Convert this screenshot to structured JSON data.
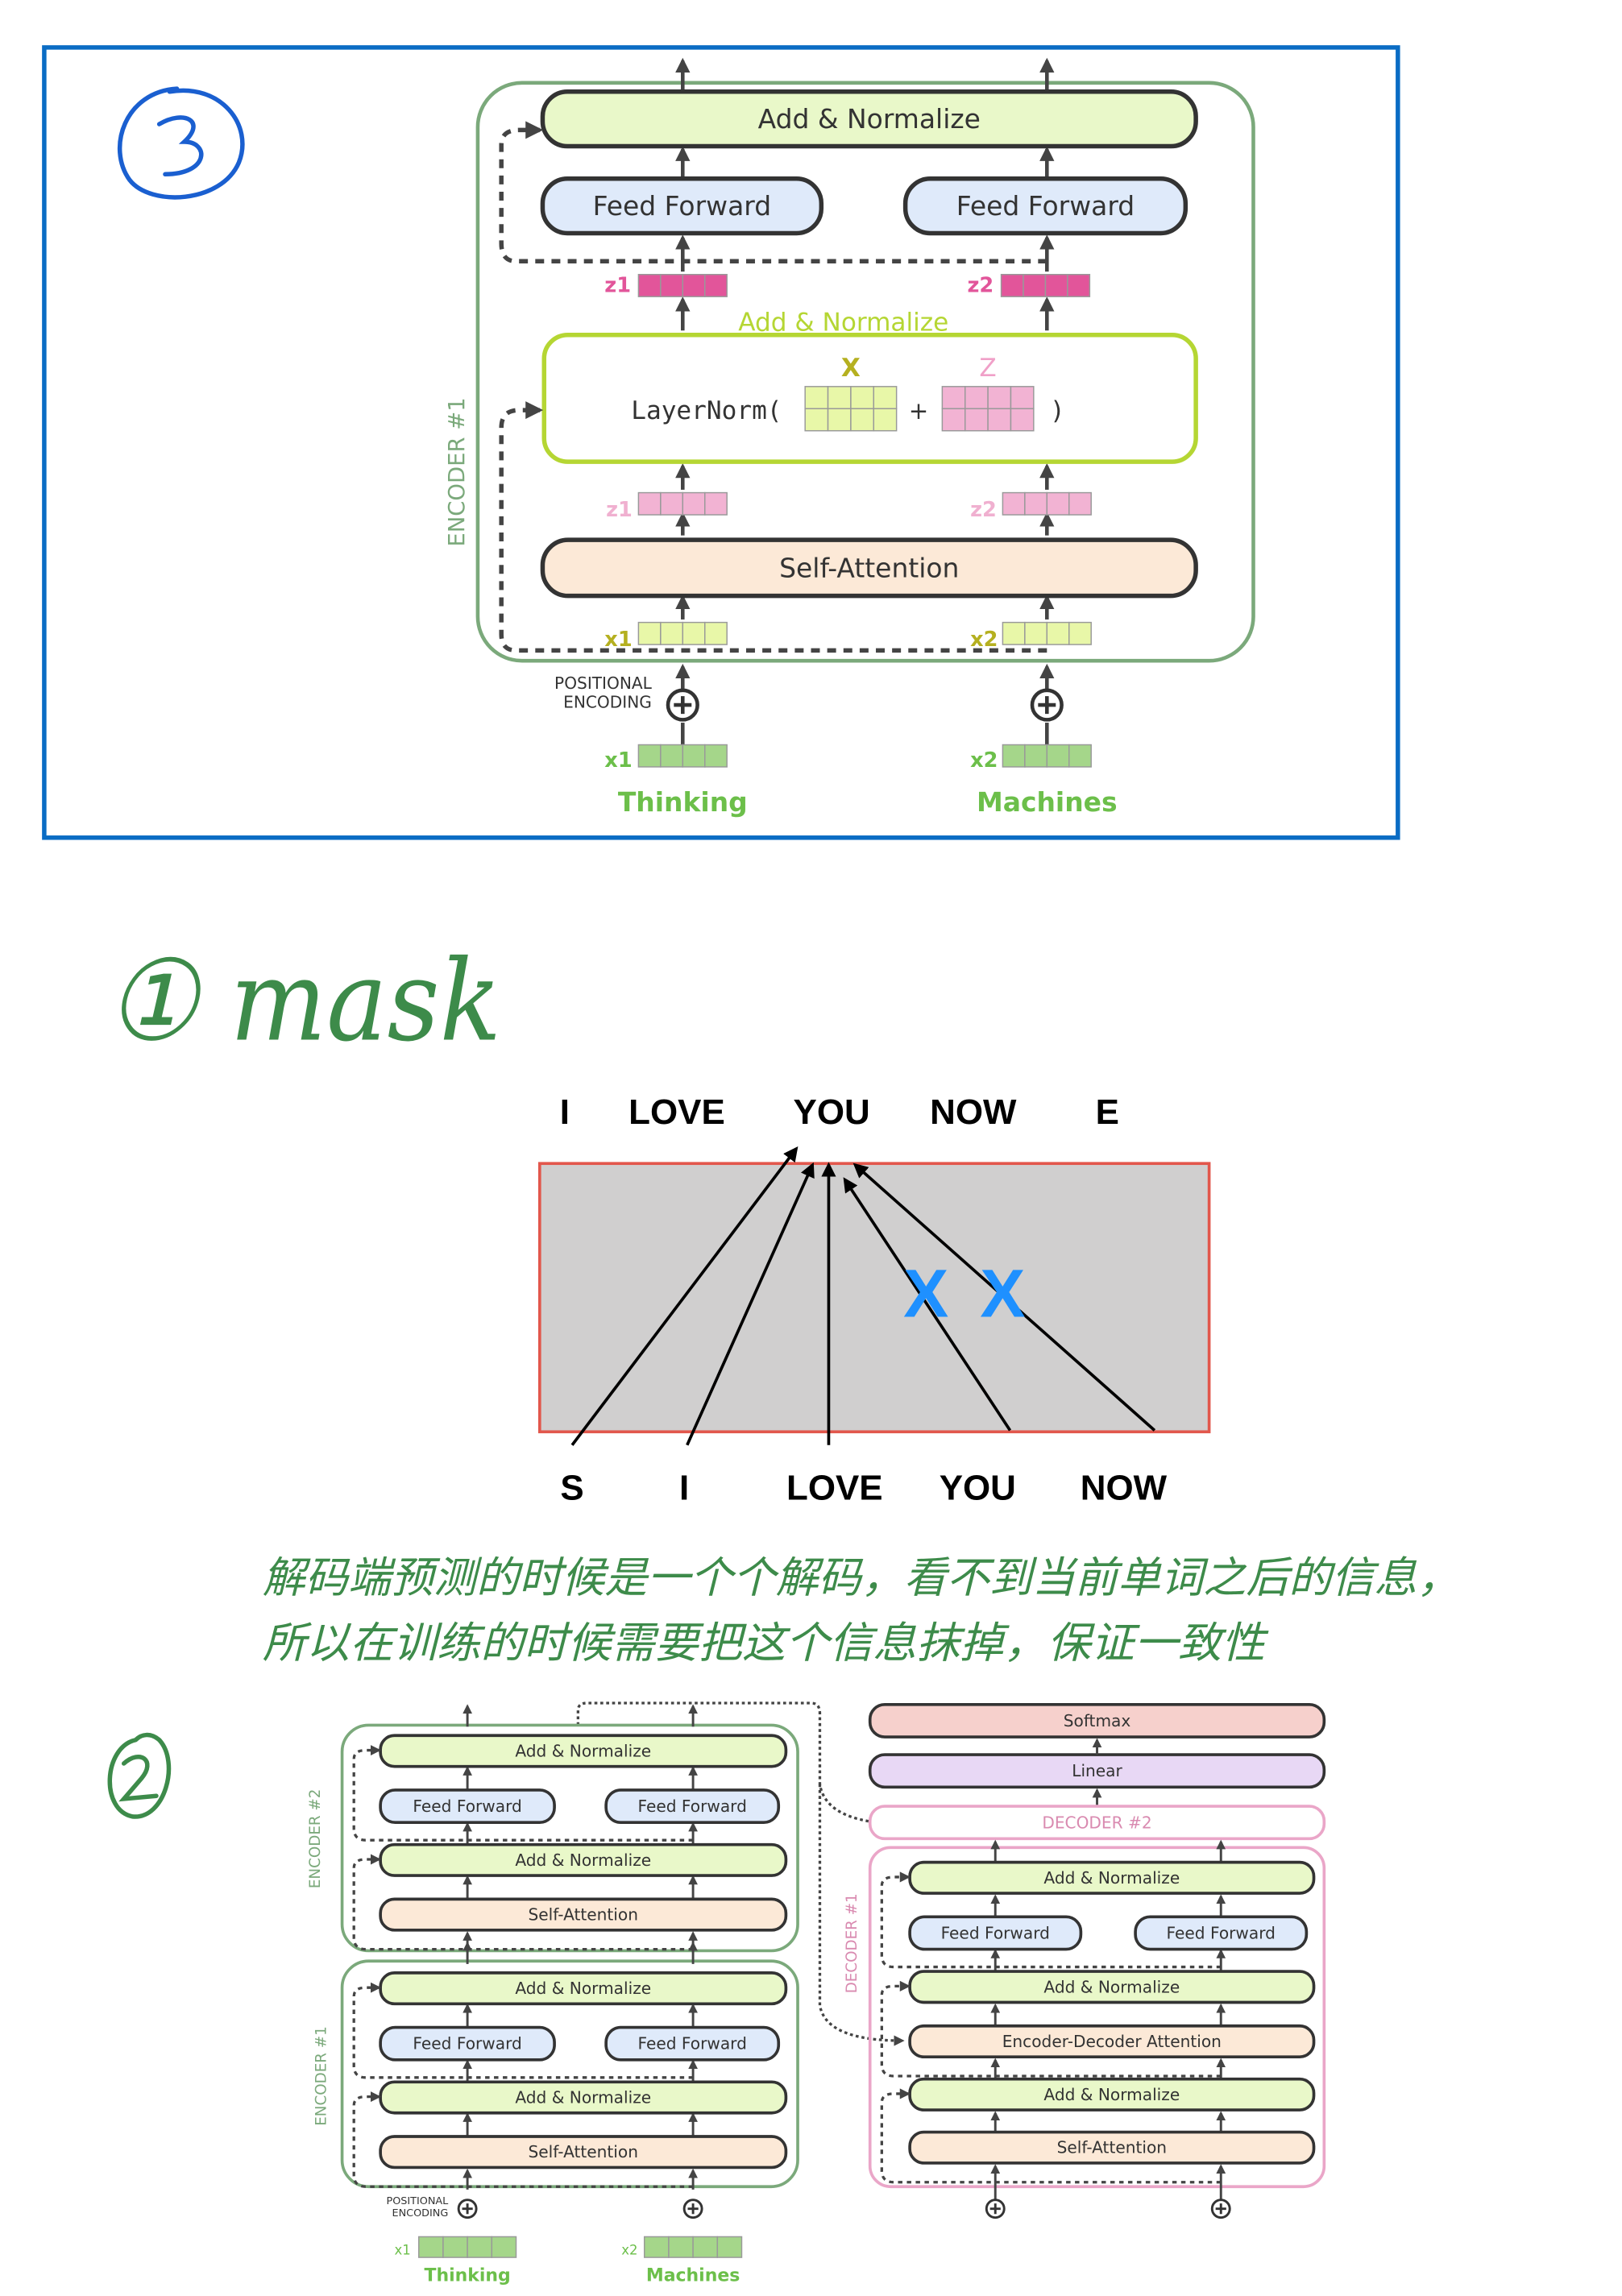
{
  "handwriting": {
    "section_3_marker": "③",
    "section_1_title": "① mask",
    "section_2_marker": "②"
  },
  "encoder_detail": {
    "encoder_label": "ENCODER #1",
    "add_normalize_top": "Add & Normalize",
    "feed_forward_left": "Feed Forward",
    "feed_forward_right": "Feed Forward",
    "z1_label": "z1",
    "z2_label": "z2",
    "add_normalize_caption": "Add & Normalize",
    "layernorm_open": "LayerNorm(",
    "plus": "+",
    "layernorm_close": ")",
    "x_matrix_label": "X",
    "z_matrix_label": "Z",
    "self_attention": "Self-Attention",
    "x1_label": "x1",
    "x2_label": "x2",
    "positional_line1": "POSITIONAL",
    "positional_line2": "ENCODING",
    "word1": "Thinking",
    "word2": "Machines"
  },
  "mask_diagram": {
    "top_tokens": [
      "I",
      "LOVE",
      "YOU",
      "NOW",
      "E"
    ],
    "bottom_tokens": [
      "S",
      "I",
      "LOVE",
      "YOU",
      "NOW"
    ],
    "blocked_marker": "X",
    "colors": {
      "box_fill": "#d0cfcf",
      "box_border": "#e2574c",
      "cross": "#1e90ff"
    }
  },
  "note": {
    "line1": "解码端预测的时候是一个个解码，看不到当前单词之后的信息，",
    "line2": "所以在训练的时候需要把这个信息抹掉，保证一致性"
  },
  "full_model": {
    "encoder2_label": "ENCODER #2",
    "encoder1_label": "ENCODER #1",
    "decoder1_label": "DECODER #1",
    "decoder2_label": "DECODER #2",
    "add_normalize": "Add & Normalize",
    "feed_forward": "Feed Forward",
    "self_attention": "Self-Attention",
    "encoder_decoder_attention": "Encoder-Decoder Attention",
    "softmax": "Softmax",
    "linear": "Linear",
    "positional_line1": "POSITIONAL",
    "positional_line2": "ENCODING",
    "x1_label": "x1",
    "x2_label": "x2",
    "word1": "Thinking",
    "word2": "Machines"
  },
  "colors": {
    "frame_blue": "#0a6cc4",
    "add_norm_fill": "#e9f8c9",
    "feed_forward_fill": "#dfeafa",
    "self_attention_fill": "#fce9d7",
    "softmax_fill": "#f6d0cc",
    "linear_fill": "#e8d8f5",
    "encoder_border": "#7ba97b",
    "decoder_border": "#eaa6c8",
    "handwriting_green": "#3d8b4a"
  }
}
